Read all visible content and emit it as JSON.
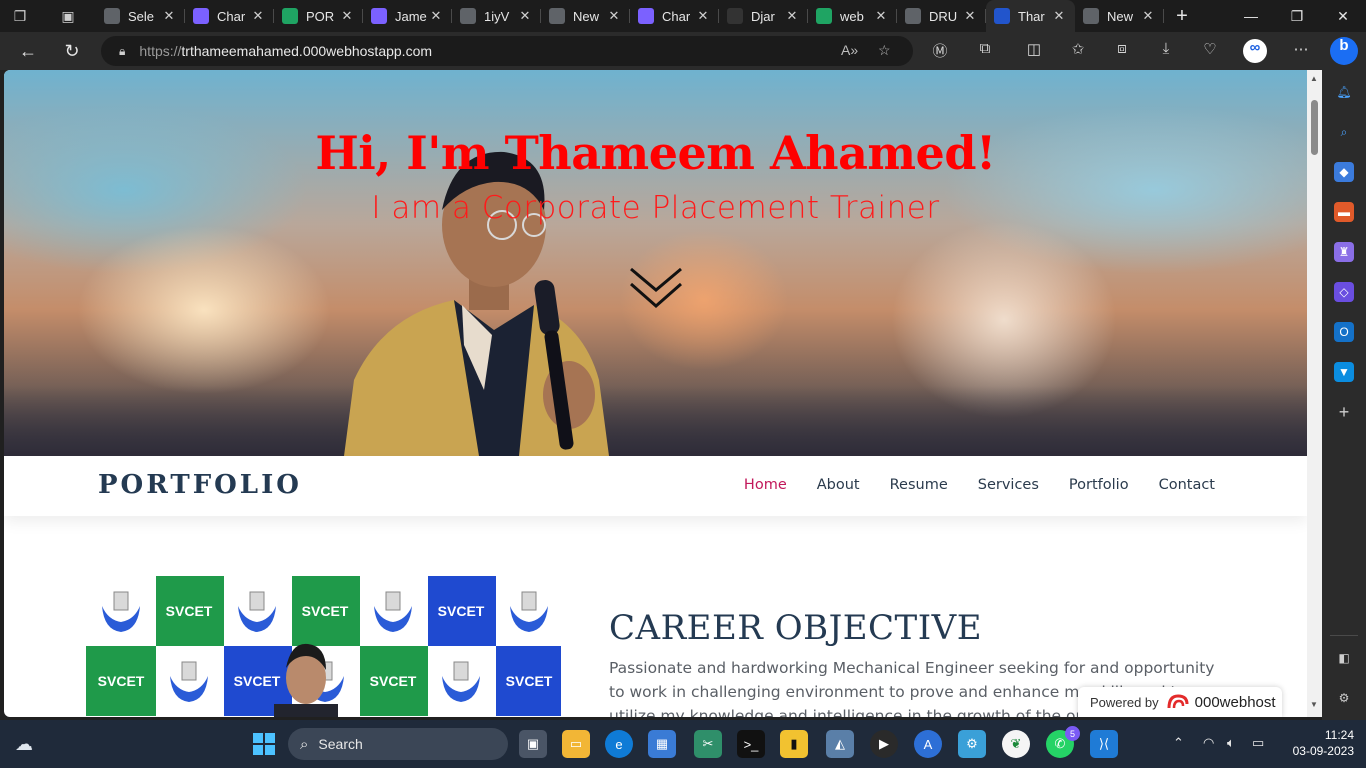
{
  "browser": {
    "tabs": [
      {
        "title": "Sele",
        "favicon": "document-icon",
        "color": "#5f6368"
      },
      {
        "title": "Char",
        "favicon": "chatgpt-icon",
        "color": "#7b61ff"
      },
      {
        "title": "POR",
        "favicon": "google-drive-icon",
        "color": "#1fa463"
      },
      {
        "title": "Jame",
        "favicon": "chatgpt-icon",
        "color": "#7b61ff"
      },
      {
        "title": "1iyV",
        "favicon": "document-icon",
        "color": "#5f6368"
      },
      {
        "title": "New",
        "favicon": "new-tab-icon",
        "color": "#5f6368"
      },
      {
        "title": "Char",
        "favicon": "chatgpt-icon",
        "color": "#7b61ff"
      },
      {
        "title": "Djar",
        "favicon": "github-icon",
        "color": "#333333"
      },
      {
        "title": "web",
        "favicon": "google-drive-icon",
        "color": "#1fa463"
      },
      {
        "title": "DRU",
        "favicon": "document-icon",
        "color": "#5f6368"
      },
      {
        "title": "Thar",
        "favicon": "portfolio-a-icon",
        "color": "#2255cc",
        "active": true
      },
      {
        "title": "New",
        "favicon": "new-tab-icon",
        "color": "#5f6368"
      }
    ],
    "url_protocol": "https://",
    "url_host": "trthameemahamed.000webhostapp.com"
  },
  "page": {
    "hero": {
      "title": "Hi, I'm Thameem Ahamed!",
      "subtitle": "I am a Corporate Placement Trainer"
    },
    "nav": {
      "brand": "PORTFOLIO",
      "links": [
        "Home",
        "About",
        "Resume",
        "Services",
        "Portfolio",
        "Contact"
      ],
      "active_link": "Home",
      "active_color": "#c2185b"
    },
    "career": {
      "title": "CAREER OBJECTIVE",
      "text": "Passionate and hardworking Mechanical Engineer seeking for and opportunity to work in challenging environment to prove and enhance my skills and to utilize my knowledge and intelligence in the growth of the organization."
    },
    "photo_banner": {
      "label": "SVCET"
    },
    "powered": {
      "prefix": "Powered by",
      "brand": "000webhost"
    }
  },
  "taskbar": {
    "search_label": "Search",
    "whatsapp_badge": "5",
    "time": "11:24",
    "date": "03-09-2023"
  }
}
